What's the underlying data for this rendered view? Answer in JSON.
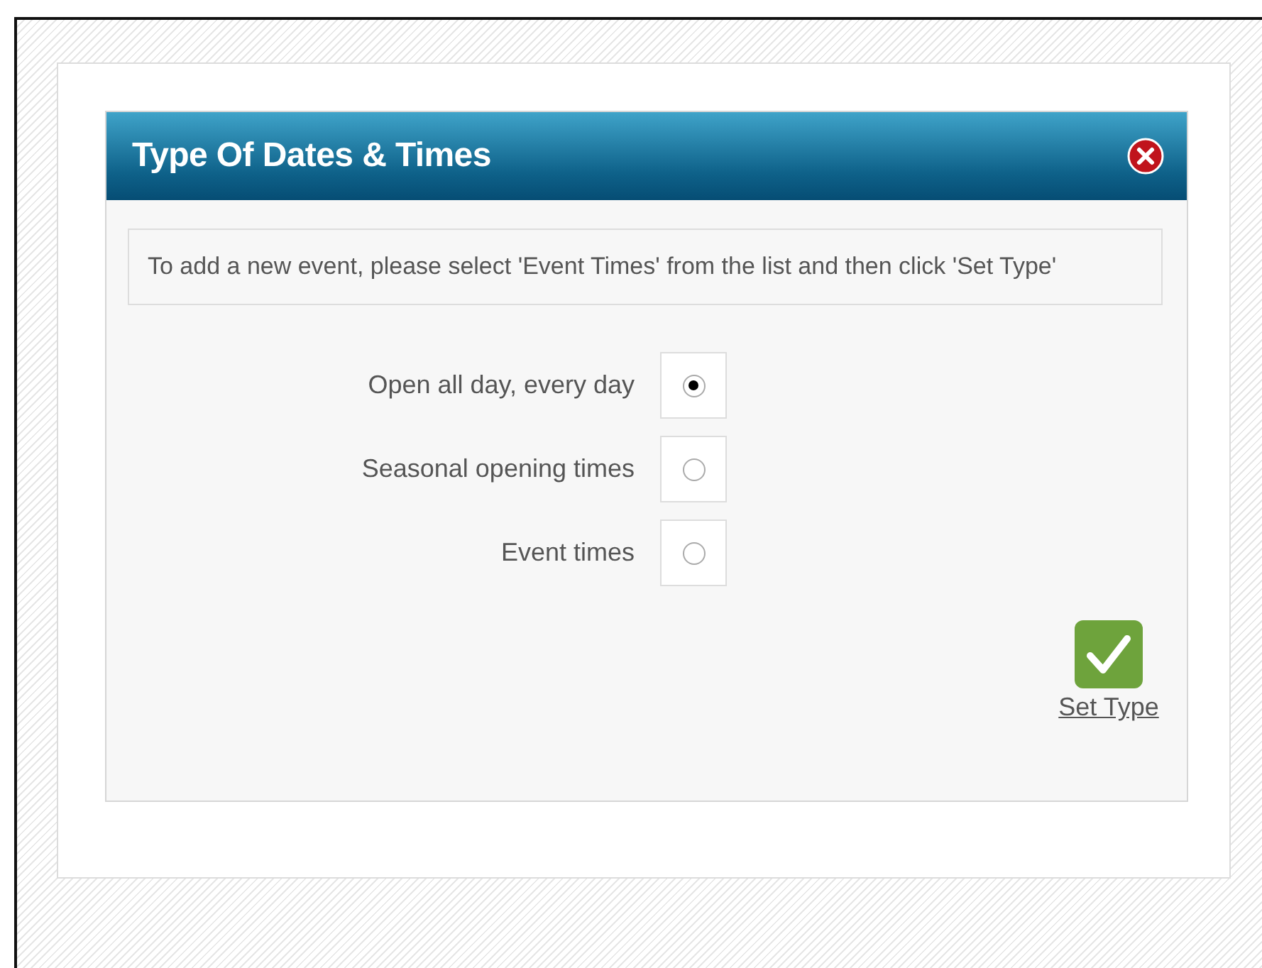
{
  "dialog": {
    "title": "Type Of Dates & Times"
  },
  "info": "To add a new event, please select 'Event Times' from the list and then click 'Set Type'",
  "options": [
    {
      "label": "Open all day, every day",
      "selected": true
    },
    {
      "label": "Seasonal opening times",
      "selected": false
    },
    {
      "label": "Event times",
      "selected": false
    }
  ],
  "action": {
    "label": "Set Type"
  }
}
